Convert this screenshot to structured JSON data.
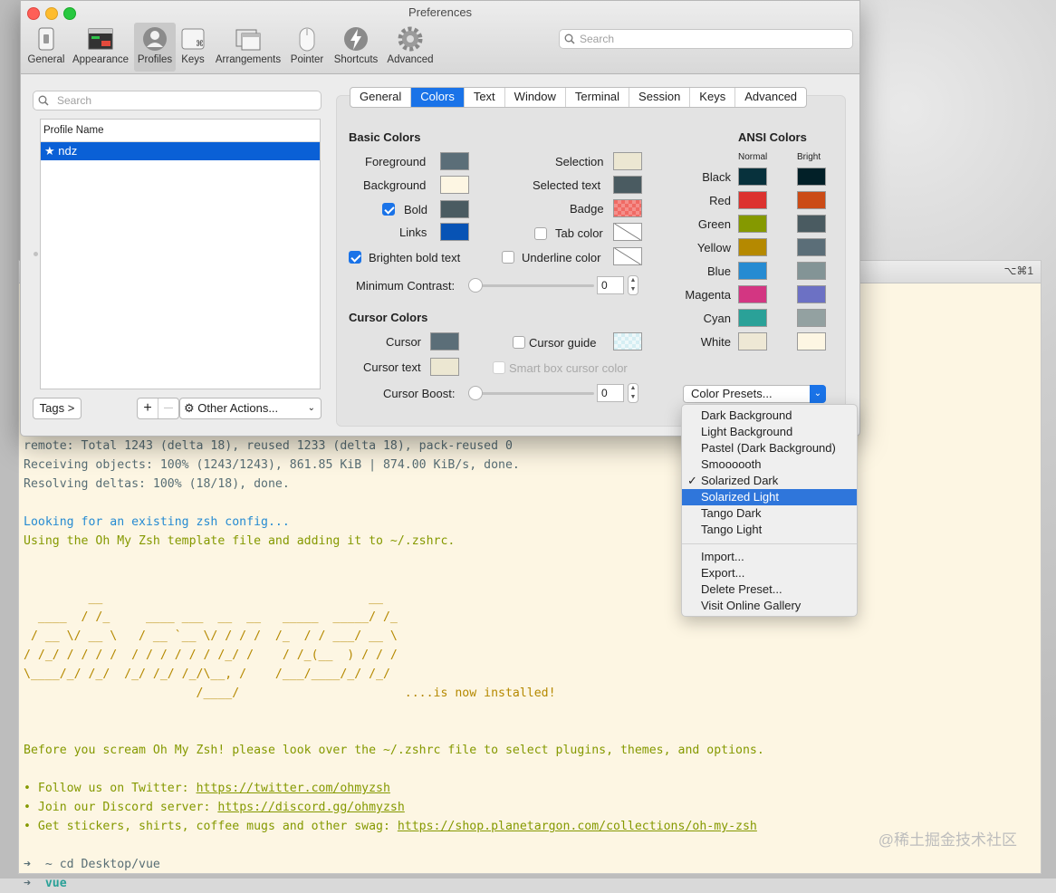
{
  "window": {
    "title": "Preferences",
    "terminal_shortcut": "⌥⌘1"
  },
  "toolbar": {
    "items": [
      {
        "label": "General",
        "icon": "switch-icon"
      },
      {
        "label": "Appearance",
        "icon": "appearance-icon"
      },
      {
        "label": "Profiles",
        "icon": "profile-icon"
      },
      {
        "label": "Keys",
        "icon": "command-key-icon"
      },
      {
        "label": "Arrangements",
        "icon": "arrangements-icon"
      },
      {
        "label": "Pointer",
        "icon": "mouse-icon"
      },
      {
        "label": "Shortcuts",
        "icon": "lightning-icon"
      },
      {
        "label": "Advanced",
        "icon": "gear-icon"
      }
    ],
    "selected": "Profiles",
    "search_placeholder": "Search"
  },
  "profiles": {
    "search_placeholder": "Search",
    "column_header": "Profile Name",
    "rows": [
      {
        "name": "ndz",
        "default": true
      }
    ],
    "tags_button": "Tags >",
    "add_button": "+",
    "remove_button": "—",
    "other_actions": "Other Actions..."
  },
  "tabs": {
    "items": [
      "General",
      "Colors",
      "Text",
      "Window",
      "Terminal",
      "Session",
      "Keys",
      "Advanced"
    ],
    "active": "Colors"
  },
  "basic_colors": {
    "title": "Basic Colors",
    "foreground": "Foreground",
    "background": "Background",
    "bold": "Bold",
    "links": "Links",
    "selection": "Selection",
    "selected_text": "Selected text",
    "badge": "Badge",
    "tab_color": "Tab color",
    "brighten_bold": "Brighten bold text",
    "underline_color": "Underline color",
    "minimum_contrast": "Minimum Contrast:",
    "minimum_contrast_value": "0",
    "colors": {
      "foreground": "#5b6e78",
      "background": "#fdf6e3",
      "bold": "#4a5b61",
      "links": "#0753b5",
      "selection": "#ece7d2",
      "selected_text": "#4a5b61",
      "badge": "#f06a64"
    }
  },
  "cursor_colors": {
    "title": "Cursor Colors",
    "cursor": "Cursor",
    "cursor_text": "Cursor text",
    "cursor_guide": "Cursor guide",
    "smart_box": "Smart box cursor color",
    "cursor_boost": "Cursor Boost:",
    "cursor_boost_value": "0",
    "colors": {
      "cursor": "#5b6e78",
      "cursor_text": "#ece7d2"
    }
  },
  "ansi": {
    "title": "ANSI Colors",
    "normal": "Normal",
    "bright": "Bright",
    "rows": [
      {
        "name": "Black",
        "normal": "#07313c",
        "bright": "#022028"
      },
      {
        "name": "Red",
        "normal": "#dc322f",
        "bright": "#cb4b16"
      },
      {
        "name": "Green",
        "normal": "#859900",
        "bright": "#4a5b61"
      },
      {
        "name": "Yellow",
        "normal": "#b58900",
        "bright": "#5b6e78"
      },
      {
        "name": "Blue",
        "normal": "#268bd2",
        "bright": "#839496"
      },
      {
        "name": "Magenta",
        "normal": "#d33682",
        "bright": "#6c71c4"
      },
      {
        "name": "Cyan",
        "normal": "#2aa198",
        "bright": "#93a1a1"
      },
      {
        "name": "White",
        "normal": "#eee8d5",
        "bright": "#fdf6e3"
      }
    ]
  },
  "presets": {
    "button_label": "Color Presets...",
    "items": [
      "Dark Background",
      "Light Background",
      "Pastel (Dark Background)",
      "Smoooooth",
      "Solarized Dark",
      "Solarized Light",
      "Tango Dark",
      "Tango Light"
    ],
    "checked": "Solarized Dark",
    "highlighted": "Solarized Light",
    "actions": [
      "Import...",
      "Export...",
      "Delete Preset...",
      "Visit Online Gallery"
    ]
  },
  "terminal": {
    "lines": [
      "remote: Total 1243 (delta 18), reused 1233 (delta 18), pack-reused 0",
      "Receiving objects: 100% (1243/1243), 861.85 KiB | 874.00 KiB/s, done.",
      "Resolving deltas: 100% (18/18), done.",
      "",
      "Looking for an existing zsh config...",
      "Using the Oh My Zsh template file and adding it to ~/.zshrc.",
      "",
      "",
      "         __                                     __   ",
      "  ____  / /_     ____ ___  __  __   _____  _____/ /_  ",
      " / __ \\/ __ \\   / __ `__ \\/ / / /  /_  / / ___/ __ \\ ",
      "/ /_/ / / / /  / / / / / / /_/ /    / /_(__  ) / / / ",
      "\\____/_/ /_/  /_/ /_/ /_/\\__, /    /___/____/_/ /_/  ",
      "                        /____/                       ....is now installed!",
      "",
      "",
      "Before you scream Oh My Zsh! please look over the ~/.zshrc file to select plugins, themes, and options.",
      "",
      "• Follow us on Twitter: ",
      "• Join our Discord server: ",
      "• Get stickers, shirts, coffee mugs and other swag: ",
      "",
      "➜  ~ cd Desktop/vue",
      "➜  vue"
    ],
    "links": {
      "twitter": "https://twitter.com/ohmyzsh",
      "discord": "https://discord.gg/ohmyzsh",
      "shop": "https://shop.planetargon.com/collections/oh-my-zsh"
    },
    "prompt_arrow": "➜",
    "prompt_dir": "vue",
    "watermark": "@稀土掘金技术社区"
  }
}
